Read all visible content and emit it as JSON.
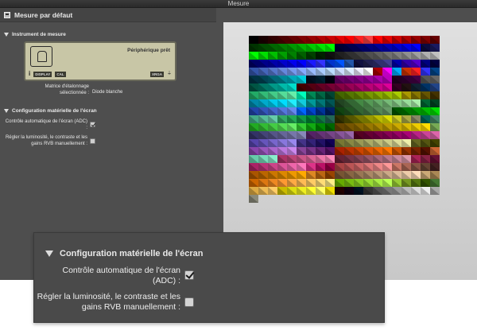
{
  "window": {
    "title": "Mesure"
  },
  "panel": {
    "title": "Mesure par défaut",
    "instrument_section": "Instrument de mesure",
    "lcd": {
      "status": "Périphérique prêt",
      "info": "i",
      "display_label": "DISPLAY",
      "cal_label": "CAL",
      "mode_label": "XRGA",
      "plug_icon": "plug-icon"
    },
    "calibration_matrix_label": "Matrice d'étalonnage sélectionnée :",
    "calibration_matrix_value": "Diode blanche",
    "screen_config_section": "Configuration matérielle de l'écran",
    "adc_label": "Contrôle automatique de l'écran (ADC) :",
    "adc_checked": true,
    "manual_label": "Régler la luminosité, le contraste et les gains RVB manuellement :",
    "manual_checked": false
  },
  "zoom": {
    "section": "Configuration matérielle de l'écran",
    "adc_label": "Contrôle automatique de l'écran (ADC) :",
    "adc_checked": true,
    "manual_label": "Régler la luminosité, le contraste et les gains RVB manuellement :",
    "manual_checked": false
  },
  "patches": {
    "rows": [
      [
        "#000000",
        "#1a0000",
        "#330000",
        "#4d0000",
        "#660000",
        "#800000",
        "#990000",
        "#b30000",
        "#cc0000",
        "#e60000",
        "#ff0000",
        "#ff2020",
        "#ff4040",
        "#ff0000",
        "#e60000",
        "#cc0000",
        "#b30000",
        "#990000",
        "#800000",
        "#660000"
      ],
      [
        "#003300",
        "#004d00",
        "#006600",
        "#008000",
        "#009900",
        "#00b300",
        "#00cc00",
        "#00e600",
        "#00ff00",
        "#000033",
        "#00004d",
        "#000066",
        "#000080",
        "#000099",
        "#0000b3",
        "#0000cc",
        "#0000e6",
        "#0000ff",
        "#0a0a40",
        "#1a1a60"
      ],
      [
        "#00ff00",
        "#00e000",
        "#00c000",
        "#00a000",
        "#008000",
        "#006000",
        "#004000",
        "#002000",
        "#101010",
        "#202020",
        "#303030",
        "#404040",
        "#505050",
        "#606060",
        "#707070",
        "#808080",
        "#909090",
        "#a0a0a0",
        "#b0b0b0",
        "#c0c0c0"
      ],
      [
        "#000066",
        "#00008a",
        "#0000aa",
        "#0000cc",
        "#0000ee",
        "#0000ff",
        "#1a1aff",
        "#3333ff",
        "#0033cc",
        "#0055ff",
        "#2255aa",
        "#101040",
        "#202050",
        "#303070",
        "#404090",
        "#0000aa",
        "#3300aa",
        "#5500cc",
        "#000080",
        "#000040"
      ],
      [
        "#3355aa",
        "#4466bb",
        "#5577cc",
        "#6688dd",
        "#7799ee",
        "#88aaff",
        "#99bbff",
        "#aaccff",
        "#bbddff",
        "#ccddff",
        "#ddeeff",
        "#eeeeff",
        "#ffffff",
        "#aa0000",
        "#ff00ff",
        "#00aaff",
        "#cc3300",
        "#ff2222",
        "#3333ff",
        "#004488"
      ],
      [
        "#003344",
        "#004455",
        "#006677",
        "#008899",
        "#00aabb",
        "#00ccdd",
        "#001122",
        "#002233",
        "#000011",
        "#660066",
        "#770077",
        "#880088",
        "#990099",
        "#aa00aa",
        "#bb00bb",
        "#220022",
        "#330033",
        "#440044",
        "#555555",
        "#666666"
      ],
      [
        "#005544",
        "#007766",
        "#009988",
        "#00bbaa",
        "#00ddcc",
        "#440000",
        "#550011",
        "#660022",
        "#770033",
        "#880044",
        "#990055",
        "#aa0066",
        "#bb0077",
        "#cc0088",
        "#dd0099",
        "#330022",
        "#221111",
        "#112233",
        "#003366",
        "#224488"
      ],
      [
        "#22aa66",
        "#33bb77",
        "#44cc88",
        "#55dd99",
        "#66eeaa",
        "#00ffbb",
        "#008855",
        "#006644",
        "#004433",
        "#446600",
        "#557700",
        "#668800",
        "#779900",
        "#88aa00",
        "#99bb00",
        "#aacc00",
        "#aa9900",
        "#887700",
        "#665500",
        "#443300"
      ],
      [
        "#0088aa",
        "#00aacc",
        "#00ccee",
        "#00ddff",
        "#22eeff",
        "#11ccdd",
        "#009999",
        "#007777",
        "#005555",
        "#224422",
        "#336633",
        "#448844",
        "#559955",
        "#66aa66",
        "#77bb77",
        "#88cc88",
        "#99dd99",
        "#aaeeaa",
        "#006633",
        "#004422"
      ],
      [
        "#2244aa",
        "#3355bb",
        "#4466cc",
        "#5577dd",
        "#6688ee",
        "#0066ff",
        "#0044cc",
        "#003399",
        "#002266",
        "#114411",
        "#225522",
        "#336633",
        "#447744",
        "#558855",
        "#669966",
        "#005500",
        "#007700",
        "#009900",
        "#00bb00",
        "#00dd00"
      ],
      [
        "#44aa88",
        "#55bb99",
        "#66ccaa",
        "#33aa66",
        "#22aa55",
        "#119944",
        "#008833",
        "#117744",
        "#226655",
        "#333300",
        "#555500",
        "#777700",
        "#999900",
        "#bbbb00",
        "#dddd00",
        "#cccc22",
        "#aaaa44",
        "#888866",
        "#006655",
        "#448866"
      ],
      [
        "#22aa22",
        "#33bb33",
        "#44cc44",
        "#55dd55",
        "#66ee66",
        "#33cc33",
        "#11aa11",
        "#008800",
        "#006600",
        "#664400",
        "#775500",
        "#886600",
        "#997700",
        "#aa8800",
        "#bb9900",
        "#ccaa00",
        "#ddbb00",
        "#eecc00",
        "#ffdd00",
        "#77aa55"
      ],
      [
        "#333366",
        "#444477",
        "#555588",
        "#666699",
        "#7777aa",
        "#8888bb",
        "#552266",
        "#663377",
        "#774488",
        "#885599",
        "#9966aa",
        "#550022",
        "#660033",
        "#770044",
        "#880055",
        "#990066",
        "#aa0077",
        "#bb2288",
        "#cc4499",
        "#dd66aa"
      ],
      [
        "#5544aa",
        "#6655bb",
        "#7766cc",
        "#8877dd",
        "#9988ee",
        "#443388",
        "#332277",
        "#221166",
        "#110055",
        "#777733",
        "#888844",
        "#999955",
        "#aaaa66",
        "#bbbb77",
        "#cccc88",
        "#dddd99",
        "#eeeeaa",
        "#666622",
        "#555511",
        "#444400"
      ],
      [
        "#8844aa",
        "#9955bb",
        "#aa66cc",
        "#bb77dd",
        "#cc88ee",
        "#884499",
        "#773388",
        "#662277",
        "#551166",
        "#aa2200",
        "#bb3300",
        "#cc4400",
        "#dd5500",
        "#ee6600",
        "#ff7700",
        "#cc5500",
        "#993300",
        "#772200",
        "#551100",
        "#cc6633"
      ],
      [
        "#66ccaa",
        "#77ddbb",
        "#88eecc",
        "#aa3366",
        "#bb4477",
        "#cc5588",
        "#dd6699",
        "#ee77aa",
        "#ff88bb",
        "#662233",
        "#773344",
        "#884455",
        "#995566",
        "#aa6677",
        "#bb7788",
        "#cc8899",
        "#dd99aa",
        "#aa2255",
        "#882244",
        "#661133"
      ],
      [
        "#aa2266",
        "#bb3377",
        "#cc4488",
        "#dd5599",
        "#ee66aa",
        "#ff77bb",
        "#dd3388",
        "#bb1166",
        "#990044",
        "#aa4444",
        "#bb5555",
        "#cc6666",
        "#dd7777",
        "#ee8888",
        "#ff9999",
        "#cc7766",
        "#aa6655",
        "#885544",
        "#664433",
        "#442222"
      ],
      [
        "#aa5500",
        "#bb6600",
        "#cc7700",
        "#dd8800",
        "#ee9900",
        "#ffaa00",
        "#dd8822",
        "#bb6611",
        "#994400",
        "#775533",
        "#886644",
        "#997755",
        "#aa8866",
        "#bb9977",
        "#ccaa88",
        "#ddbb99",
        "#eeccaa",
        "#ffddbb",
        "#ccaa77",
        "#aa8855"
      ],
      [
        "#cc6600",
        "#dd7711",
        "#ee8822",
        "#ff9933",
        "#ffaa44",
        "#ffbb55",
        "#ffcc66",
        "#ffdd77",
        "#ffee88",
        "#66aa00",
        "#77bb11",
        "#88cc22",
        "#99dd33",
        "#aaee44",
        "#bbff55",
        "#99cc33",
        "#779922",
        "#557711",
        "#335500",
        "#447733"
      ],
      [
        "#ddaa44",
        "#eebb55",
        "#ffcc66",
        "#ccbb00",
        "#dddd11",
        "#eeee22",
        "#ffff33",
        "#ffff66",
        "#eedd00",
        "#220000",
        "#110011",
        "#001122",
        "#333333",
        "#555555",
        "#777777",
        "#999999",
        "#bbbbbb",
        "#dddddd",
        "#eeeeee",
        "#aaaaaa"
      ]
    ],
    "last": "#8a8a7a"
  }
}
